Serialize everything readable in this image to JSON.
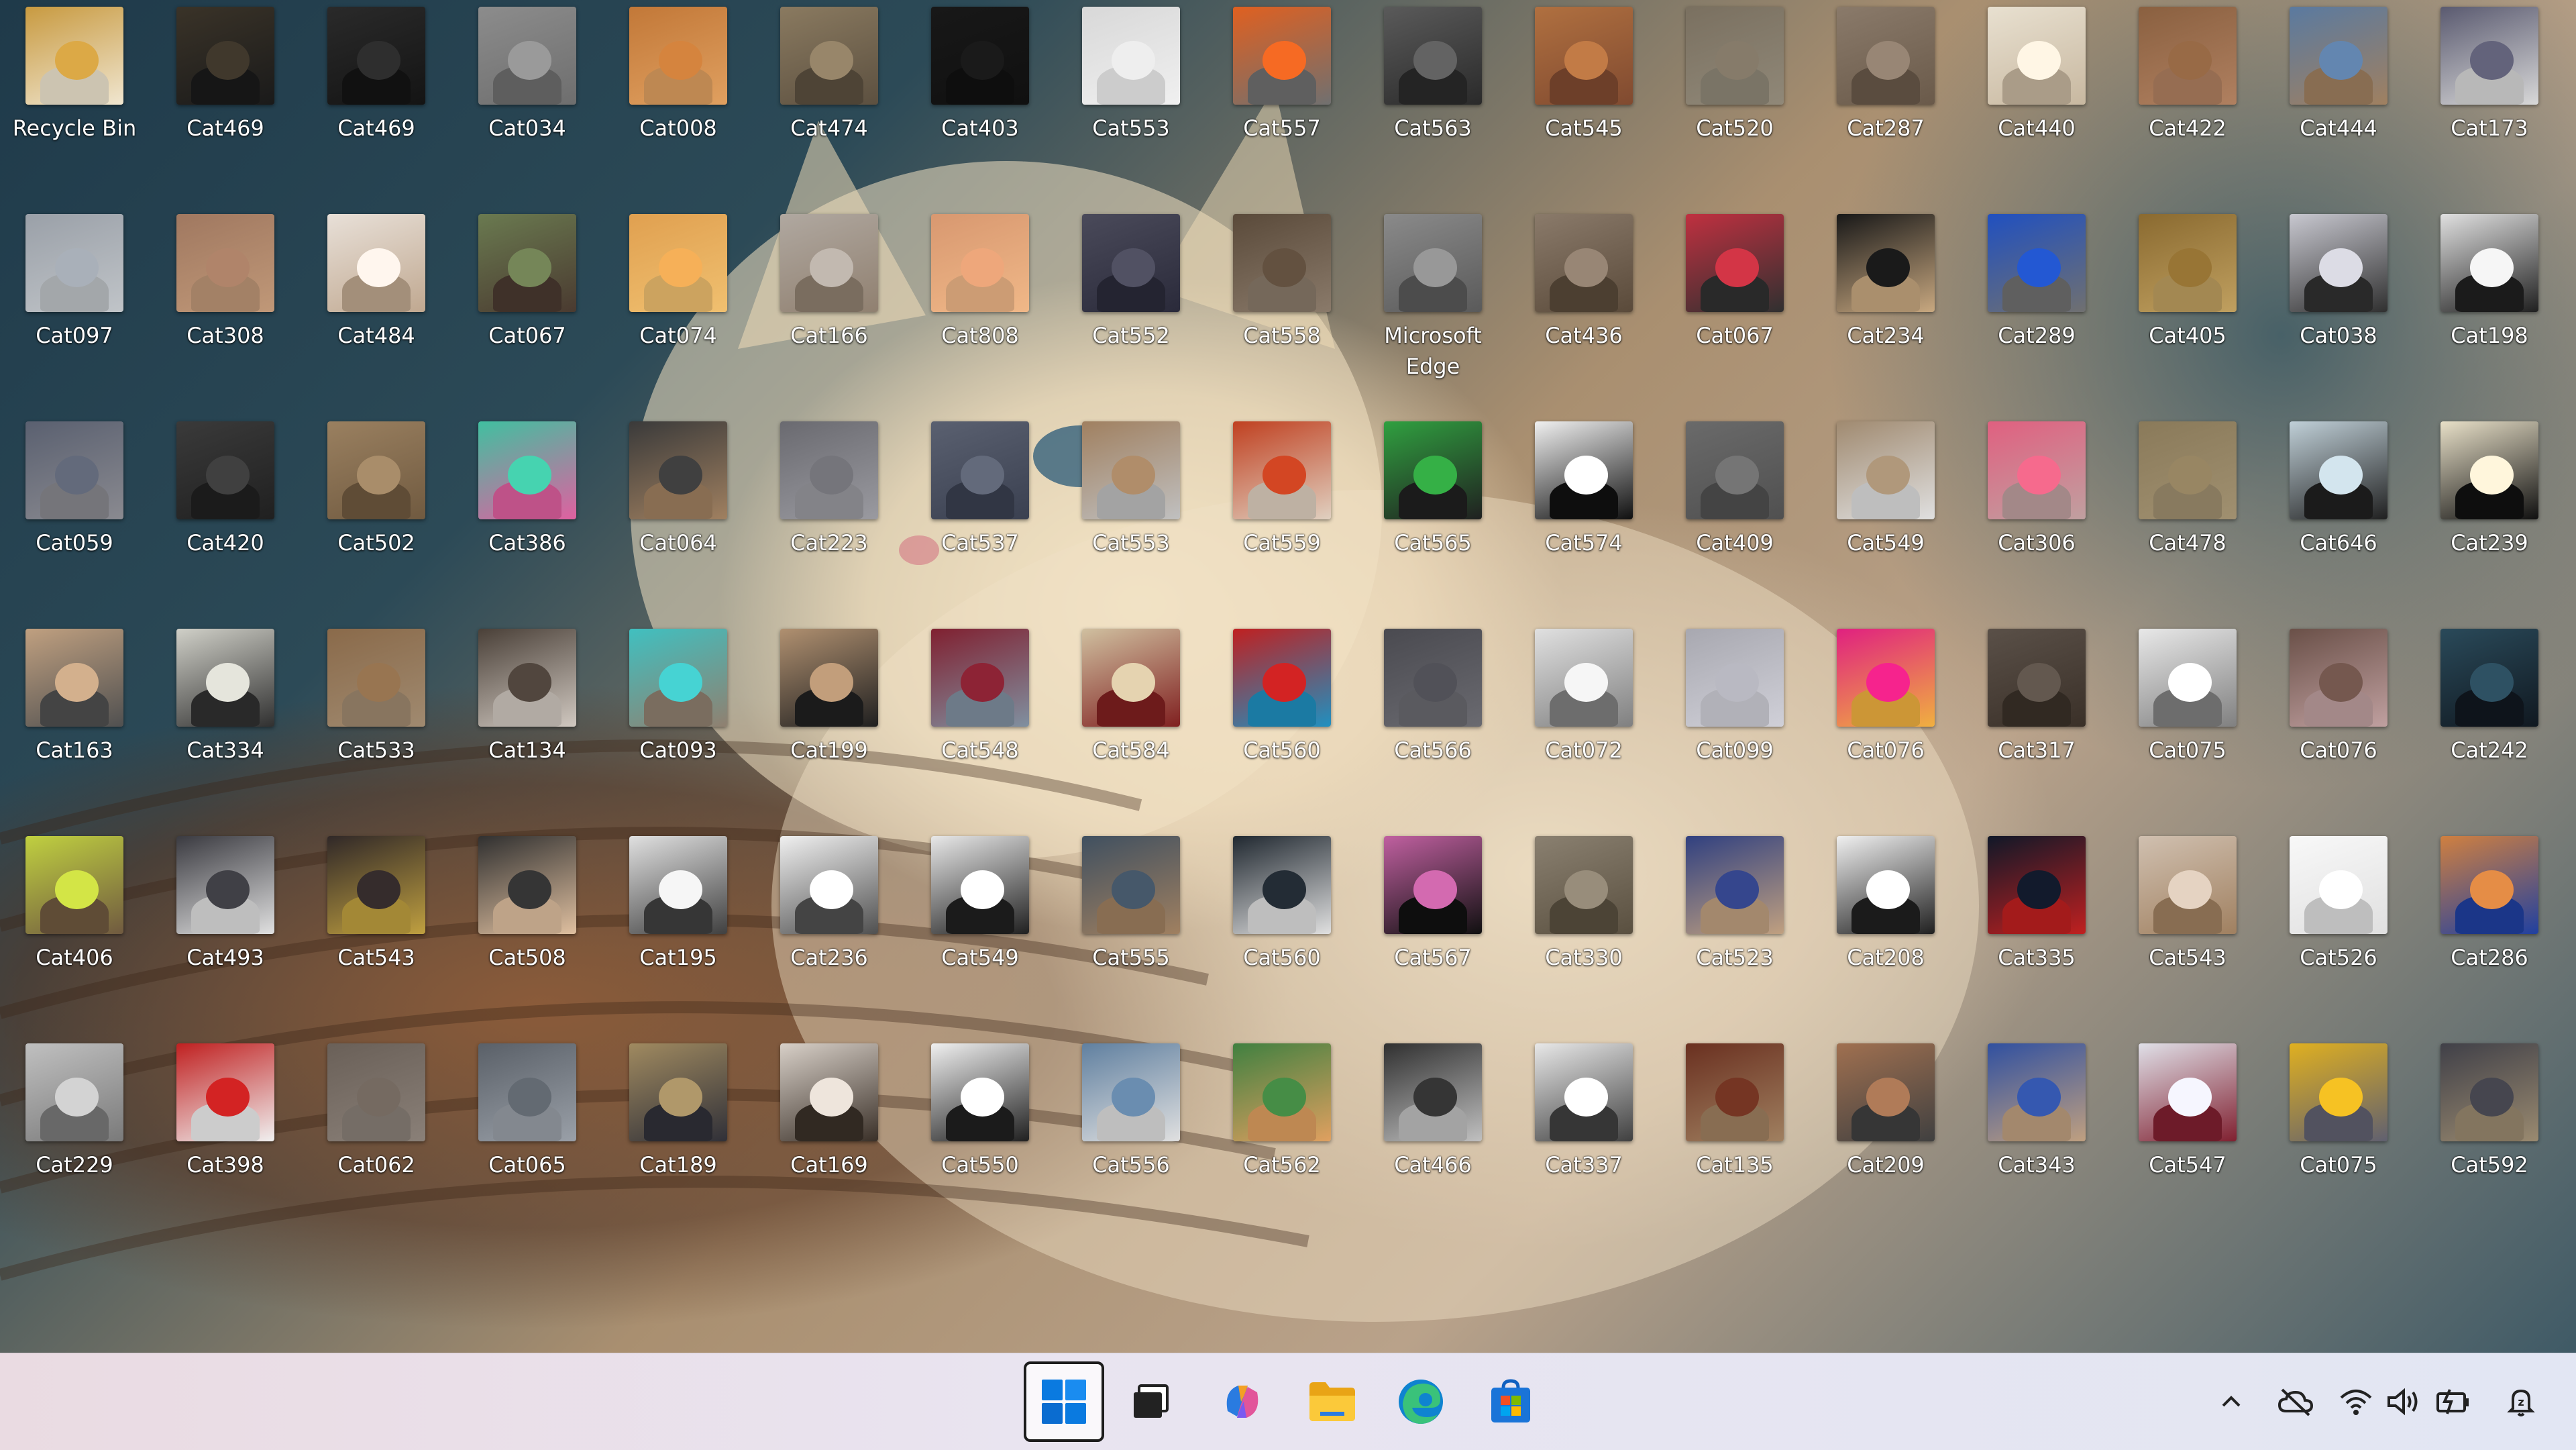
{
  "desktop": {
    "columns": 17,
    "icons": [
      {
        "label": "Recycle Bin",
        "colors": [
          "#c89a40",
          "#f0e6d0"
        ],
        "type": "recycle"
      },
      {
        "label": "Cat469",
        "colors": [
          "#3a3328",
          "#1a1a1a"
        ]
      },
      {
        "label": "Cat469",
        "colors": [
          "#2a2a2a",
          "#141414"
        ]
      },
      {
        "label": "Cat034",
        "colors": [
          "#8c8c8c",
          "#6e6e6e"
        ]
      },
      {
        "label": "Cat008",
        "colors": [
          "#c27838",
          "#e0a060"
        ]
      },
      {
        "label": "Cat474",
        "colors": [
          "#8a7a60",
          "#5c5040"
        ]
      },
      {
        "label": "Cat403",
        "colors": [
          "#181818",
          "#101010"
        ]
      },
      {
        "label": "Cat553",
        "colors": [
          "#d8d8d8",
          "#f0f0f0"
        ]
      },
      {
        "label": "Cat557",
        "colors": [
          "#e06020",
          "#707070"
        ]
      },
      {
        "label": "Cat563",
        "colors": [
          "#5a5a5a",
          "#2a2a2a"
        ]
      },
      {
        "label": "Cat545",
        "colors": [
          "#b07040",
          "#804a30"
        ]
      },
      {
        "label": "Cat520",
        "colors": [
          "#7a7060",
          "#908878"
        ]
      },
      {
        "label": "Cat287",
        "colors": [
          "#8a7a6a",
          "#6a5a4a"
        ]
      },
      {
        "label": "Cat440",
        "colors": [
          "#e8e0d0",
          "#c8b8a0"
        ]
      },
      {
        "label": "Cat422",
        "colors": [
          "#8a6040",
          "#b08060"
        ]
      },
      {
        "label": "Cat444",
        "colors": [
          "#5a7aa0",
          "#a08060"
        ]
      },
      {
        "label": "Cat173",
        "colors": [
          "#5a5a70",
          "#d8d8d8"
        ]
      },
      {
        "label": "Cat097",
        "colors": [
          "#9aa0a8",
          "#c0c4c8"
        ]
      },
      {
        "label": "Cat308",
        "colors": [
          "#a07860",
          "#c09878"
        ]
      },
      {
        "label": "Cat484",
        "colors": [
          "#e8e0d8",
          "#c0a890"
        ]
      },
      {
        "label": "Cat067",
        "colors": [
          "#6a7a50",
          "#4a3a30"
        ]
      },
      {
        "label": "Cat074",
        "colors": [
          "#e0a050",
          "#f0c070"
        ]
      },
      {
        "label": "Cat166",
        "colors": [
          "#b0a8a0",
          "#908070"
        ]
      },
      {
        "label": "Cat808",
        "colors": [
          "#d89870",
          "#f0b888"
        ]
      },
      {
        "label": "Cat552",
        "colors": [
          "#4a4a5a",
          "#2a2a3a"
        ]
      },
      {
        "label": "Cat558",
        "colors": [
          "#5a4a3a",
          "#8a7a6a"
        ]
      },
      {
        "label": "Microsoft Edge",
        "colors": [
          "#8a8a8a",
          "#5a5a5a"
        ]
      },
      {
        "label": "Cat436",
        "colors": [
          "#8a7a6a",
          "#5a4a3a"
        ]
      },
      {
        "label": "Cat067",
        "colors": [
          "#c03040",
          "#303030"
        ]
      },
      {
        "label": "Cat234",
        "colors": [
          "#181818",
          "#c8a880"
        ]
      },
      {
        "label": "Cat289",
        "colors": [
          "#2050c0",
          "#707070"
        ]
      },
      {
        "label": "Cat405",
        "colors": [
          "#8a6a30",
          "#c0a060"
        ]
      },
      {
        "label": "Cat038",
        "colors": [
          "#c8c8d0",
          "#303030"
        ]
      },
      {
        "label": "Cat198",
        "colors": [
          "#e0e0e0",
          "#202020"
        ]
      },
      {
        "label": "Cat059",
        "colors": [
          "#5a6070",
          "#8a8a90"
        ]
      },
      {
        "label": "Cat420",
        "colors": [
          "#3a3a3a",
          "#202020"
        ]
      },
      {
        "label": "Cat502",
        "colors": [
          "#9a8060",
          "#705a40"
        ]
      },
      {
        "label": "Cat386",
        "colors": [
          "#40c0a0",
          "#e060a0"
        ]
      },
      {
        "label": "Cat064",
        "colors": [
          "#3a3a3a",
          "#a08060"
        ]
      },
      {
        "label": "Cat223",
        "colors": [
          "#6a6a70",
          "#9a9aa0"
        ]
      },
      {
        "label": "Cat537",
        "colors": [
          "#5a6070",
          "#3a4050"
        ]
      },
      {
        "label": "Cat553",
        "colors": [
          "#a08060",
          "#c0c0c0"
        ]
      },
      {
        "label": "Cat559",
        "colors": [
          "#c04020",
          "#e0d0c0"
        ]
      },
      {
        "label": "Cat565",
        "colors": [
          "#30a040",
          "#202020"
        ]
      },
      {
        "label": "Cat574",
        "colors": [
          "#f0f0f0",
          "#101010"
        ]
      },
      {
        "label": "Cat409",
        "colors": [
          "#6a6a6a",
          "#505050"
        ]
      },
      {
        "label": "Cat549",
        "colors": [
          "#a08a70",
          "#e0e0e0"
        ]
      },
      {
        "label": "Cat306",
        "colors": [
          "#e06080",
          "#c0a0a0"
        ]
      },
      {
        "label": "Cat478",
        "colors": [
          "#8a7a5a",
          "#a09070"
        ]
      },
      {
        "label": "Cat646",
        "colors": [
          "#c0d0d8",
          "#202020"
        ]
      },
      {
        "label": "Cat239",
        "colors": [
          "#e8e0c8",
          "#101010"
        ]
      },
      {
        "label": "Cat163",
        "colors": [
          "#c0a080",
          "#505050"
        ]
      },
      {
        "label": "Cat334",
        "colors": [
          "#d0d0c8",
          "#303030"
        ]
      },
      {
        "label": "Cat533",
        "colors": [
          "#8a6a4a",
          "#a08a70"
        ]
      },
      {
        "label": "Cat134",
        "colors": [
          "#4a4038",
          "#d0c8c0"
        ]
      },
      {
        "label": "Cat093",
        "colors": [
          "#40c0c0",
          "#908070"
        ]
      },
      {
        "label": "Cat199",
        "colors": [
          "#b09070",
          "#202020"
        ]
      },
      {
        "label": "Cat548",
        "colors": [
          "#802030",
          "#8090a0"
        ]
      },
      {
        "label": "Cat584",
        "colors": [
          "#d0c0a0",
          "#802020"
        ]
      },
      {
        "label": "Cat560",
        "colors": [
          "#c02020",
          "#2090c0"
        ]
      },
      {
        "label": "Cat566",
        "colors": [
          "#4a4a50",
          "#6a6a70"
        ]
      },
      {
        "label": "Cat072",
        "colors": [
          "#e0e0e0",
          "#808080"
        ]
      },
      {
        "label": "Cat099",
        "colors": [
          "#a8a8b0",
          "#d0d0d8"
        ]
      },
      {
        "label": "Cat076",
        "colors": [
          "#e02080",
          "#f0b040"
        ]
      },
      {
        "label": "Cat317",
        "colors": [
          "#5a5048",
          "#3a3028"
        ]
      },
      {
        "label": "Cat075",
        "colors": [
          "#e8e8e8",
          "#808080"
        ]
      },
      {
        "label": "Cat076",
        "colors": [
          "#6a5048",
          "#c0a0a0"
        ]
      },
      {
        "label": "Cat242",
        "colors": [
          "#2a4a5a",
          "#101820"
        ]
      },
      {
        "label": "Cat406",
        "colors": [
          "#c0d040",
          "#705a40"
        ]
      },
      {
        "label": "Cat493",
        "colors": [
          "#3a3a40",
          "#e0e0e0"
        ]
      },
      {
        "label": "Cat543",
        "colors": [
          "#302828",
          "#c0a040"
        ]
      },
      {
        "label": "Cat508",
        "colors": [
          "#303030",
          "#e0c0a0"
        ]
      },
      {
        "label": "Cat195",
        "colors": [
          "#e0e0e0",
          "#404040"
        ]
      },
      {
        "label": "Cat236",
        "colors": [
          "#f0f0f0",
          "#505050"
        ]
      },
      {
        "label": "Cat549",
        "colors": [
          "#e8e8e8",
          "#202020"
        ]
      },
      {
        "label": "Cat555",
        "colors": [
          "#405060",
          "#a08060"
        ]
      },
      {
        "label": "Cat560",
        "colors": [
          "#202830",
          "#e0e0e0"
        ]
      },
      {
        "label": "Cat567",
        "colors": [
          "#c060a0",
          "#101010"
        ]
      },
      {
        "label": "Cat330",
        "colors": [
          "#8a8070",
          "#5a5040"
        ]
      },
      {
        "label": "Cat523",
        "colors": [
          "#304080",
          "#c0a080"
        ]
      },
      {
        "label": "Cat208",
        "colors": [
          "#f0f0f0",
          "#202020"
        ]
      },
      {
        "label": "Cat335",
        "colors": [
          "#101828",
          "#c02020"
        ]
      },
      {
        "label": "Cat543",
        "colors": [
          "#d0c0b0",
          "#a08060"
        ]
      },
      {
        "label": "Cat526",
        "colors": [
          "#f8f8f8",
          "#e0e0e0"
        ]
      },
      {
        "label": "Cat286",
        "colors": [
          "#d08040",
          "#2040a0"
        ]
      },
      {
        "label": "Cat229",
        "colors": [
          "#c0c0c0",
          "#7a7a7a"
        ]
      },
      {
        "label": "Cat398",
        "colors": [
          "#c02020",
          "#f0f0f0"
        ]
      },
      {
        "label": "Cat062",
        "colors": [
          "#6a6058",
          "#8a8078"
        ]
      },
      {
        "label": "Cat065",
        "colors": [
          "#5a6068",
          "#9aa0a8"
        ]
      },
      {
        "label": "Cat189",
        "colors": [
          "#a08a60",
          "#303038"
        ]
      },
      {
        "label": "Cat169",
        "colors": [
          "#d8d0c8",
          "#3a3028"
        ]
      },
      {
        "label": "Cat550",
        "colors": [
          "#f0f0f0",
          "#202020"
        ]
      },
      {
        "label": "Cat556",
        "colors": [
          "#6080a0",
          "#e0e0e0"
        ]
      },
      {
        "label": "Cat562",
        "colors": [
          "#408040",
          "#e0a060"
        ]
      },
      {
        "label": "Cat466",
        "colors": [
          "#303030",
          "#c0c0c0"
        ]
      },
      {
        "label": "Cat337",
        "colors": [
          "#e8e8e8",
          "#404040"
        ]
      },
      {
        "label": "Cat135",
        "colors": [
          "#6a3020",
          "#a08060"
        ]
      },
      {
        "label": "Cat209",
        "colors": [
          "#a07050",
          "#404040"
        ]
      },
      {
        "label": "Cat343",
        "colors": [
          "#3050a0",
          "#c0a080"
        ]
      },
      {
        "label": "Cat547",
        "colors": [
          "#e0e0e8",
          "#802030"
        ]
      },
      {
        "label": "Cat075",
        "colors": [
          "#e0b020",
          "#606070"
        ]
      },
      {
        "label": "Cat592",
        "colors": [
          "#404048",
          "#9a8a70"
        ]
      }
    ]
  },
  "taskbar": {
    "apps": [
      {
        "name": "start-button",
        "icon": "windows-logo-icon",
        "active": true
      },
      {
        "name": "task-view-button",
        "icon": "task-view-icon",
        "active": false
      },
      {
        "name": "copilot-button",
        "icon": "copilot-icon",
        "active": false
      },
      {
        "name": "file-explorer-button",
        "icon": "folder-icon",
        "active": false
      },
      {
        "name": "edge-button",
        "icon": "edge-icon",
        "active": false
      },
      {
        "name": "store-button",
        "icon": "store-icon",
        "active": false
      }
    ],
    "tray": [
      {
        "name": "show-hidden-icons-button",
        "icon": "chevron-up-icon"
      },
      {
        "name": "onedrive-button",
        "icon": "cloud-offline-icon"
      },
      {
        "name": "network-button",
        "icon": "wifi-icon"
      },
      {
        "name": "volume-button",
        "icon": "speaker-icon"
      },
      {
        "name": "battery-button",
        "icon": "battery-charging-icon"
      },
      {
        "name": "notifications-button",
        "icon": "bell-icon"
      }
    ],
    "accent": "#0078d4"
  }
}
